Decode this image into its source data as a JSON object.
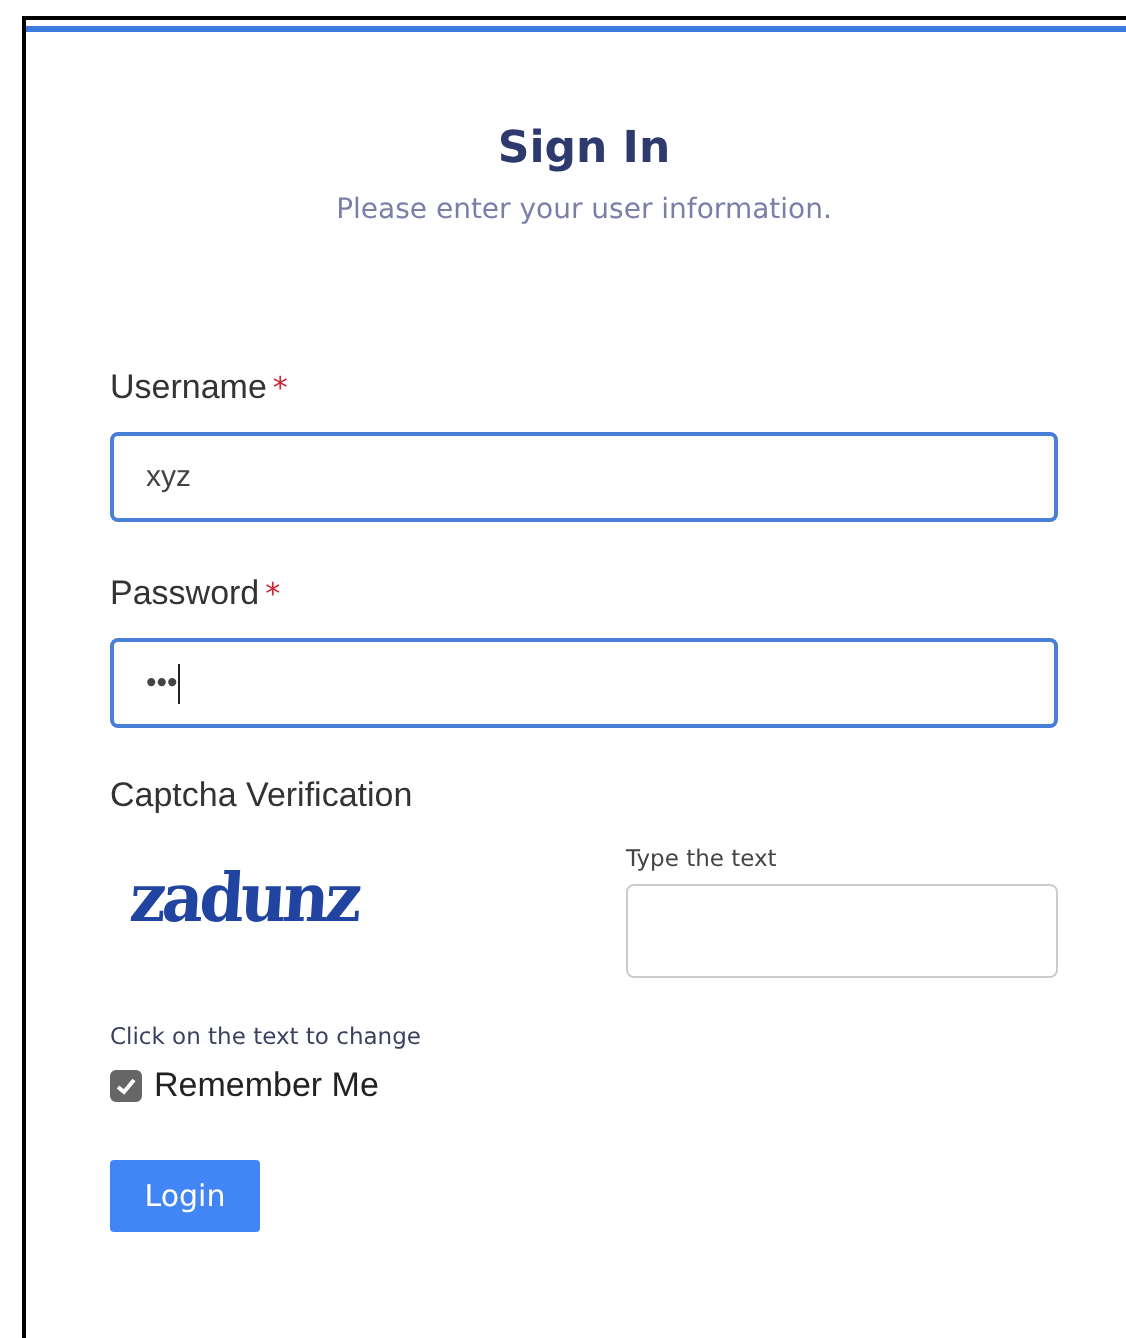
{
  "title": "Sign In",
  "subtitle": "Please enter your user information.",
  "fields": [
    {
      "label": "Username",
      "required_mark": "*",
      "value": "xyz",
      "focused": true,
      "cursor": false
    },
    {
      "label": "Password",
      "required_mark": "*",
      "value": "•••",
      "focused": true,
      "cursor": true
    }
  ],
  "captcha": {
    "heading": "Captcha Verification",
    "text": "zadunz",
    "input_label": "Type the text",
    "hint": "Click on the text to change"
  },
  "remember": {
    "label": "Remember Me",
    "checked": true
  },
  "login_button": "Login"
}
